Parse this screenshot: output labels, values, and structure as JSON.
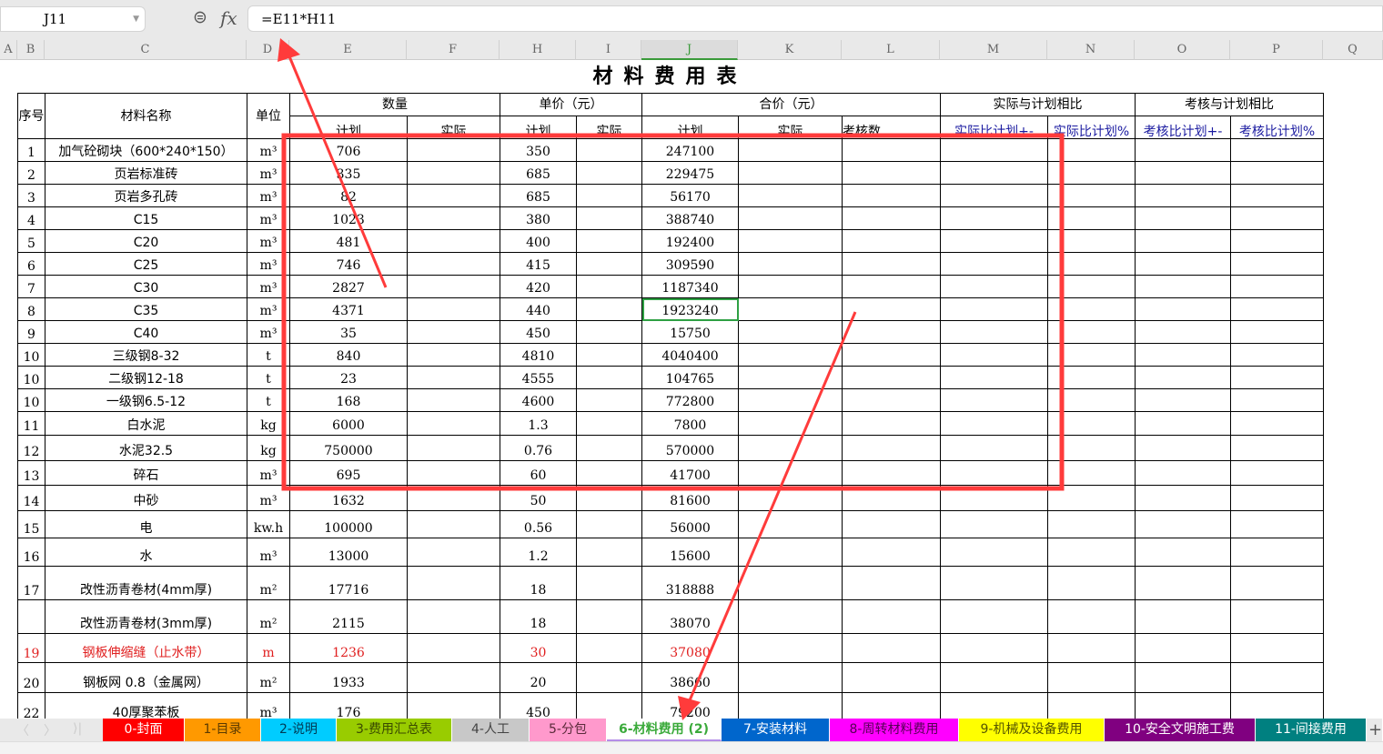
{
  "formula_bar": {
    "name_box": "J11",
    "formula": "=E11*H11",
    "zoom_icon": "zoom-icon",
    "fx_label": "fx"
  },
  "columns": [
    "A",
    "B",
    "C",
    "D",
    "E",
    "F",
    "H",
    "I",
    "J",
    "K",
    "L",
    "M",
    "N",
    "O",
    "P",
    "Q"
  ],
  "selected_column": "J",
  "sheet": {
    "title": "材料费用表",
    "headers": {
      "seq": "序号",
      "name": "材料名称",
      "unit": "单位",
      "qty": "数量",
      "price": "单价（元）",
      "total": "合价（元）",
      "actual_vs_plan": "实际与计划相比",
      "audit_vs_plan": "考核与计划相比",
      "plan": "计划",
      "actual": "实际",
      "audit_num": "考核数",
      "m": "实际比计划+-",
      "n": "实际比计划%",
      "o": "考核比计划+-",
      "p": "考核比计划%"
    },
    "rows": [
      {
        "seq": "1",
        "name": "加气砼砌块（600*240*150）",
        "unit": "m³",
        "qty": "706",
        "price": "350",
        "total": "247100"
      },
      {
        "seq": "2",
        "name": "页岩标准砖",
        "unit": "m³",
        "qty": "335",
        "price": "685",
        "total": "229475"
      },
      {
        "seq": "3",
        "name": "页岩多孔砖",
        "unit": "m³",
        "qty": "82",
        "price": "685",
        "total": "56170"
      },
      {
        "seq": "4",
        "name": "C15",
        "unit": "m³",
        "qty": "1023",
        "price": "380",
        "total": "388740"
      },
      {
        "seq": "5",
        "name": "C20",
        "unit": "m³",
        "qty": "481",
        "price": "400",
        "total": "192400"
      },
      {
        "seq": "6",
        "name": "C25",
        "unit": "m³",
        "qty": "746",
        "price": "415",
        "total": "309590"
      },
      {
        "seq": "7",
        "name": "C30",
        "unit": "m³",
        "qty": "2827",
        "price": "420",
        "total": "1187340"
      },
      {
        "seq": "8",
        "name": "C35",
        "unit": "m³",
        "qty": "4371",
        "price": "440",
        "total": "1923240"
      },
      {
        "seq": "9",
        "name": "C40",
        "unit": "m³",
        "qty": "35",
        "price": "450",
        "total": "15750"
      },
      {
        "seq": "10",
        "name": "三级钢8-32",
        "unit": "t",
        "qty": "840",
        "price": "4810",
        "total": "4040400"
      },
      {
        "seq": "10",
        "name": "二级钢12-18",
        "unit": "t",
        "qty": "23",
        "price": "4555",
        "total": "104765"
      },
      {
        "seq": "10",
        "name": "一级钢6.5-12",
        "unit": "t",
        "qty": "168",
        "price": "4600",
        "total": "772800"
      },
      {
        "seq": "11",
        "name": "白水泥",
        "unit": "kg",
        "qty": "6000",
        "price": "1.3",
        "total": "7800"
      },
      {
        "seq": "12",
        "name": "水泥32.5",
        "unit": "kg",
        "qty": "750000",
        "price": "0.76",
        "total": "570000"
      },
      {
        "seq": "13",
        "name": "碎石",
        "unit": "m³",
        "qty": "695",
        "price": "60",
        "total": "41700"
      },
      {
        "seq": "14",
        "name": "中砂",
        "unit": "m³",
        "qty": "1632",
        "price": "50",
        "total": "81600"
      },
      {
        "seq": "15",
        "name": "电",
        "unit": "kw.h",
        "qty": "100000",
        "price": "0.56",
        "total": "56000"
      },
      {
        "seq": "16",
        "name": "水",
        "unit": "m³",
        "qty": "13000",
        "price": "1.2",
        "total": "15600"
      },
      {
        "seq": "17",
        "name": "改性沥青卷材(4mm厚)",
        "unit": "m²",
        "qty": "17716",
        "price": "18",
        "total": "318888"
      },
      {
        "seq": "",
        "name": "改性沥青卷材(3mm厚)",
        "unit": "m²",
        "qty": "2115",
        "price": "18",
        "total": "38070"
      },
      {
        "seq": "19",
        "name": "钢板伸缩缝（止水带）",
        "unit": "m",
        "qty": "1236",
        "price": "30",
        "total": "37080",
        "highlight": true
      },
      {
        "seq": "20",
        "name": "钢板网 0.8（金属网）",
        "unit": "m²",
        "qty": "1933",
        "price": "20",
        "total": "38660"
      },
      {
        "seq": "22",
        "name": "40厚聚苯板",
        "unit": "m³",
        "qty": "176",
        "price": "450",
        "total": "79200"
      }
    ]
  },
  "sheet_tabs": [
    {
      "label": "0-封面",
      "bg": "#ff0000",
      "fg": "#ffffff"
    },
    {
      "label": "1-目录",
      "bg": "#ff9900",
      "fg": "#5a3a00"
    },
    {
      "label": "2-说明",
      "bg": "#00ccff",
      "fg": "#003a55"
    },
    {
      "label": "3-费用汇总表",
      "bg": "#99cc00",
      "fg": "#3a4a00"
    },
    {
      "label": "4-人工",
      "bg": "#c8c8c8",
      "fg": "#444444"
    },
    {
      "label": "5-分包",
      "bg": "#ff99cc",
      "fg": "#5a2a3a"
    },
    {
      "label": "6-材料费用 (2)",
      "bg": "#ffffff",
      "fg": "#3aaa3a",
      "active": true
    },
    {
      "label": "7-安装材料",
      "bg": "#0066cc",
      "fg": "#ffffff"
    },
    {
      "label": "8-周转材料费用",
      "bg": "#ff00ff",
      "fg": "#550055"
    },
    {
      "label": "9-机械及设备费用",
      "bg": "#ffff00",
      "fg": "#555500"
    },
    {
      "label": "10-安全文明施工费",
      "bg": "#800080",
      "fg": "#ffffff"
    },
    {
      "label": "11-间接费用",
      "bg": "#008080",
      "fg": "#ffffff"
    }
  ],
  "add_sheet_label": "+",
  "annotation_color": "#ff3b3b"
}
